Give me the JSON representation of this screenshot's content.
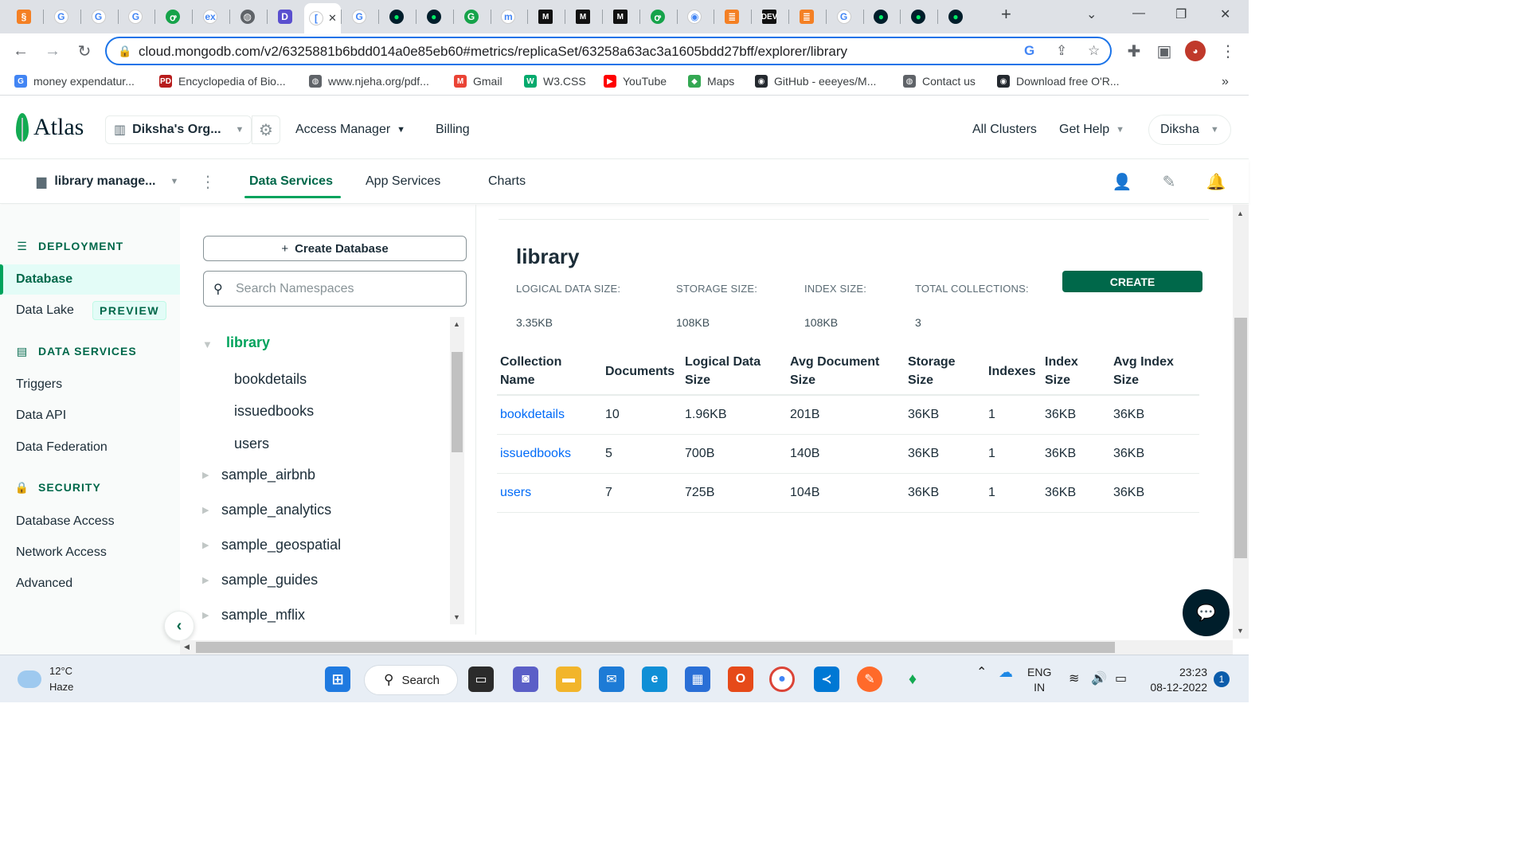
{
  "browser": {
    "url": "cloud.mongodb.com/v2/6325881b6bdd014a0e85eb60#metrics/replicaSet/63258a63ac3a1605bdd27bff/explorer/library",
    "tabs": [
      {
        "icon": "swirl-icon",
        "glyph": "§"
      },
      {
        "icon": "google-icon",
        "glyph": "G"
      },
      {
        "icon": "google-icon",
        "glyph": "G"
      },
      {
        "icon": "google-icon",
        "glyph": "G"
      },
      {
        "icon": "geeksforgeeks-icon",
        "glyph": "ꝍ"
      },
      {
        "icon": "ex-icon",
        "glyph": "ex"
      },
      {
        "icon": "globe-icon",
        "glyph": "◍"
      },
      {
        "icon": "app-icon",
        "glyph": "D"
      },
      {
        "icon": "active-tab-icon",
        "glyph": "["
      },
      {
        "icon": "google-icon",
        "glyph": "G"
      },
      {
        "icon": "mongodb-leaf-icon",
        "glyph": "●"
      },
      {
        "icon": "mongodb-leaf-icon",
        "glyph": "●"
      },
      {
        "icon": "grammarly-icon",
        "glyph": "G"
      },
      {
        "icon": "m-icon",
        "glyph": "m"
      },
      {
        "icon": "medium-icon",
        "glyph": "M"
      },
      {
        "icon": "medium-icon",
        "glyph": "M"
      },
      {
        "icon": "medium-icon",
        "glyph": "M"
      },
      {
        "icon": "geeksforgeeks-icon",
        "glyph": "ꝍ"
      },
      {
        "icon": "eye-icon",
        "glyph": "◉"
      },
      {
        "icon": "stackoverflow-icon",
        "glyph": "≣"
      },
      {
        "icon": "dev-icon",
        "glyph": "DEV"
      },
      {
        "icon": "stackoverflow-icon",
        "glyph": "≣"
      },
      {
        "icon": "google-icon",
        "glyph": "G"
      },
      {
        "icon": "mongodb-leaf-icon",
        "glyph": "●"
      },
      {
        "icon": "mongodb-leaf-icon",
        "glyph": "●"
      },
      {
        "icon": "mongodb-leaf-icon",
        "glyph": "●"
      }
    ],
    "bookmarks": [
      {
        "label": "money expendatur...",
        "icon": "google-icon"
      },
      {
        "label": "Encyclopedia of Bio...",
        "icon": "pd-icon"
      },
      {
        "label": "www.njeha.org/pdf...",
        "icon": "globe-icon"
      },
      {
        "label": "Gmail",
        "icon": "gmail-icon"
      },
      {
        "label": "W3.CSS",
        "icon": "w3-icon"
      },
      {
        "label": "YouTube",
        "icon": "youtube-icon"
      },
      {
        "label": "Maps",
        "icon": "maps-icon"
      },
      {
        "label": "GitHub - eeeyes/M...",
        "icon": "github-icon"
      },
      {
        "label": "Contact us",
        "icon": "globe-icon"
      },
      {
        "label": "Download free O'R...",
        "icon": "github-icon"
      }
    ]
  },
  "atlas": {
    "logo": "Atlas",
    "org": "Diksha's Org...",
    "nav": {
      "access_manager": "Access Manager",
      "billing": "Billing",
      "all_clusters": "All Clusters",
      "get_help": "Get Help",
      "user": "Diksha"
    },
    "project": "library manage...",
    "subtabs": {
      "data_services": "Data Services",
      "app_services": "App Services",
      "charts": "Charts"
    }
  },
  "sidebar": {
    "deployment": "DEPLOYMENT",
    "database": "Database",
    "data_lake": "Data Lake",
    "preview": "PREVIEW",
    "data_services": "DATA SERVICES",
    "triggers": "Triggers",
    "data_api": "Data API",
    "data_federation": "Data Federation",
    "security": "SECURITY",
    "database_access": "Database Access",
    "network_access": "Network Access",
    "advanced": "Advanced"
  },
  "namespaces": {
    "create_db": "Create Database",
    "search_placeholder": "Search Namespaces",
    "selected_db": "library",
    "collections": [
      "bookdetails",
      "issuedbooks",
      "users"
    ],
    "other_dbs": [
      "sample_airbnb",
      "sample_analytics",
      "sample_geospatial",
      "sample_guides",
      "sample_mflix"
    ]
  },
  "main": {
    "title": "library",
    "stats": {
      "logical_label": "LOGICAL DATA SIZE:",
      "logical_value": "3.35KB",
      "storage_label": "STORAGE SIZE:",
      "storage_value": "108KB",
      "index_label": "INDEX SIZE:",
      "index_value": "108KB",
      "collections_label": "TOTAL COLLECTIONS:",
      "collections_value": "3"
    },
    "create_button": "CREATE",
    "columns": [
      [
        "Collection",
        "Name"
      ],
      [
        "Documents",
        ""
      ],
      [
        "Logical Data",
        "Size"
      ],
      [
        "Avg Document",
        "Size"
      ],
      [
        "Storage",
        "Size"
      ],
      [
        "Indexes",
        ""
      ],
      [
        "Index",
        "Size"
      ],
      [
        "Avg Index",
        "Size"
      ]
    ],
    "rows": [
      [
        "bookdetails",
        "10",
        "1.96KB",
        "201B",
        "36KB",
        "1",
        "36KB",
        "36KB"
      ],
      [
        "issuedbooks",
        "5",
        "700B",
        "140B",
        "36KB",
        "1",
        "36KB",
        "36KB"
      ],
      [
        "users",
        "7",
        "725B",
        "104B",
        "36KB",
        "1",
        "36KB",
        "36KB"
      ]
    ]
  },
  "taskbar": {
    "temp": "12°C",
    "weather": "Haze",
    "search": "Search",
    "lang1": "ENG",
    "lang2": "IN",
    "time": "23:23",
    "date": "08-12-2022",
    "notifications": "1"
  },
  "colors": {
    "accent": "#00684a",
    "link": "#016bf8",
    "brand_green": "#00a35c"
  }
}
